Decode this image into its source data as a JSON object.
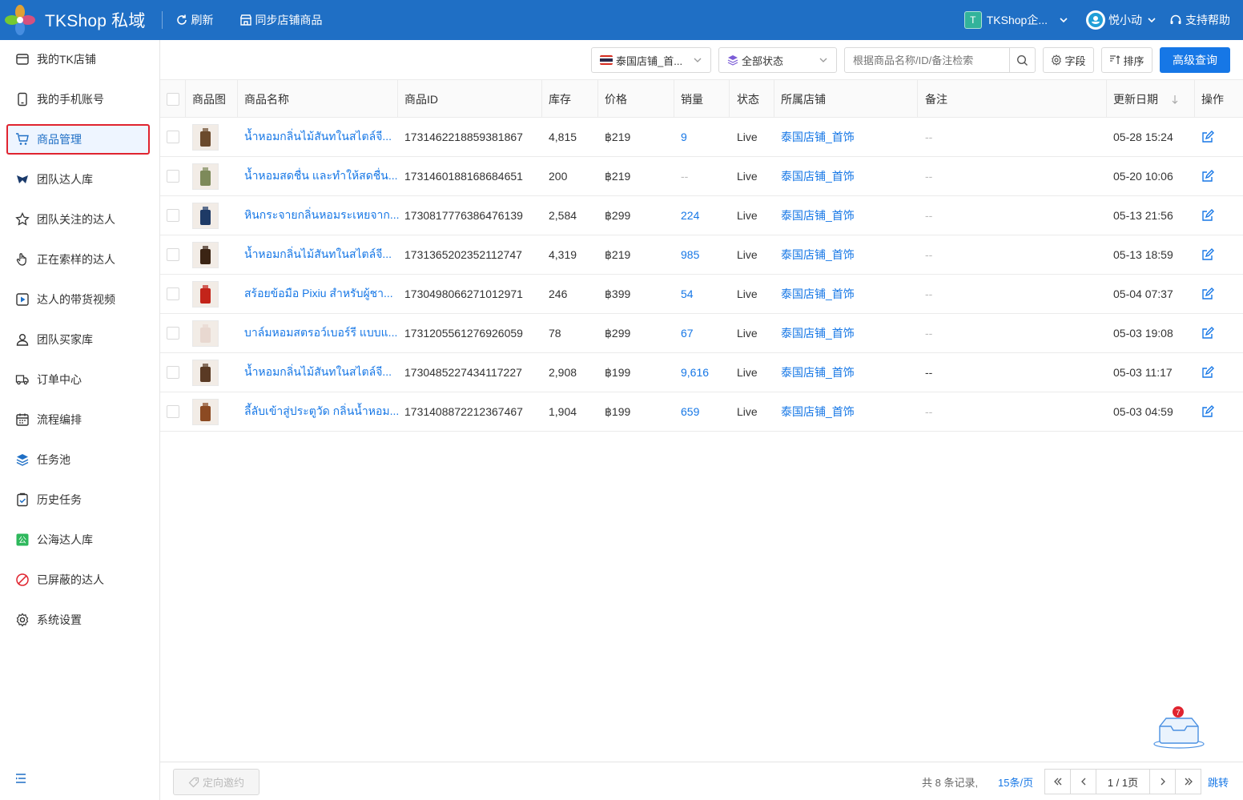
{
  "app": {
    "brand": "TKShop 私域",
    "refresh_label": "刷新",
    "sync_label": "同步店铺商品",
    "shop_badge": "T",
    "shop_name": "TKShop企...",
    "user_name": "悦小动",
    "help_label": "支持帮助",
    "accent_color": "#1f6fc5"
  },
  "sidebar": {
    "items": [
      {
        "label": "我的TK店铺",
        "icon": "store-icon"
      },
      {
        "label": "我的手机账号",
        "icon": "phone-icon"
      },
      {
        "label": "商品管理",
        "icon": "cart-icon",
        "active": true
      },
      {
        "label": "团队达人库",
        "icon": "tiktok-icon"
      },
      {
        "label": "团队关注的达人",
        "icon": "star-icon"
      },
      {
        "label": "正在索样的达人",
        "icon": "hand-icon"
      },
      {
        "label": "达人的带货视频",
        "icon": "play-icon"
      },
      {
        "label": "团队买家库",
        "icon": "user-icon"
      },
      {
        "label": "订单中心",
        "icon": "truck-icon"
      },
      {
        "label": "流程编排",
        "icon": "calendar-icon"
      },
      {
        "label": "任务池",
        "icon": "layers-icon"
      },
      {
        "label": "历史任务",
        "icon": "clipboard-check-icon"
      },
      {
        "label": "公海达人库",
        "icon": "public-icon"
      },
      {
        "label": "已屏蔽的达人",
        "icon": "block-icon"
      },
      {
        "label": "系统设置",
        "icon": "gear-icon"
      }
    ]
  },
  "toolbar": {
    "shop_filter": "泰国店铺_首...",
    "status_filter": "全部状态",
    "search_placeholder": "根据商品名称/ID/备注检索",
    "fields_label": "字段",
    "sort_label": "排序",
    "advanced_label": "高级查询"
  },
  "table": {
    "headers": {
      "image": "商品图",
      "name": "商品名称",
      "id": "商品ID",
      "stock": "库存",
      "price": "价格",
      "sales": "销量",
      "status": "状态",
      "shop": "所属店铺",
      "remark": "备注",
      "updated": "更新日期",
      "actions": "操作"
    },
    "rows": [
      {
        "name": "น้ำหอมกลิ่นไม้สันทในสไตล์จี...",
        "id": "1731462218859381867",
        "stock": "4,815",
        "price": "฿219",
        "sales": "9",
        "status": "Live",
        "shop": "泰国店铺_首饰",
        "remark": "--",
        "updated": "05-28 15:24",
        "thumb_color": "#6b4a2c"
      },
      {
        "name": "น้ำหอมสดชื่น และทำให้สดชื่น...",
        "id": "1731460188168684651",
        "stock": "200",
        "price": "฿219",
        "sales": "--",
        "status": "Live",
        "shop": "泰国店铺_首饰",
        "remark": "--",
        "updated": "05-20 10:06",
        "thumb_color": "#7d8a5a"
      },
      {
        "name": "หินกระจายกลิ่นหอมระเหยจาก...",
        "id": "1730817776386476139",
        "stock": "2,584",
        "price": "฿299",
        "sales": "224",
        "status": "Live",
        "shop": "泰国店铺_首饰",
        "remark": "--",
        "updated": "05-13 21:56",
        "thumb_color": "#1e3a66"
      },
      {
        "name": "น้ำหอมกลิ่นไม้สันทในสไตล์จี...",
        "id": "1731365202352112747",
        "stock": "4,319",
        "price": "฿219",
        "sales": "985",
        "status": "Live",
        "shop": "泰国店铺_首饰",
        "remark": "--",
        "updated": "05-13 18:59",
        "thumb_color": "#3b2414"
      },
      {
        "name": "สร้อยข้อมือ Pixiu สำหรับผู้ชา...",
        "id": "1730498066271012971",
        "stock": "246",
        "price": "฿399",
        "sales": "54",
        "status": "Live",
        "shop": "泰国店铺_首饰",
        "remark": "--",
        "updated": "05-04 07:37",
        "thumb_color": "#c3241a"
      },
      {
        "name": "บาล์มหอมสตรอว์เบอร์รี แบบแ...",
        "id": "1731205561276926059",
        "stock": "78",
        "price": "฿299",
        "sales": "67",
        "status": "Live",
        "shop": "泰国店铺_首饰",
        "remark": "--",
        "updated": "05-03 19:08",
        "thumb_color": "#e8d8d0"
      },
      {
        "name": "น้ำหอมกลิ่นไม้สันทในสไตล์จี...",
        "id": "1730485227434117227",
        "stock": "2,908",
        "price": "฿199",
        "sales": "9,616",
        "status": "Live",
        "shop": "泰国店铺_首饰",
        "remark": "--",
        "updated": "05-03 11:17",
        "thumb_color": "#5a3a24"
      },
      {
        "name": "ลี้ลับเข้าสู่ประตูวัด กลิ่นน้ำหอม...",
        "id": "1731408872212367467",
        "stock": "1,904",
        "price": "฿199",
        "sales": "659",
        "status": "Live",
        "shop": "泰国店铺_首饰",
        "remark": "--",
        "updated": "05-03 04:59",
        "thumb_color": "#8c4a22"
      }
    ]
  },
  "footer": {
    "invite_label": "定向邀约",
    "total_text": "共 8 条记录,",
    "page_size": "15条/页",
    "page_text": "1 / 1页",
    "jump_label": "跳转"
  },
  "inbox": {
    "badge": "7"
  }
}
